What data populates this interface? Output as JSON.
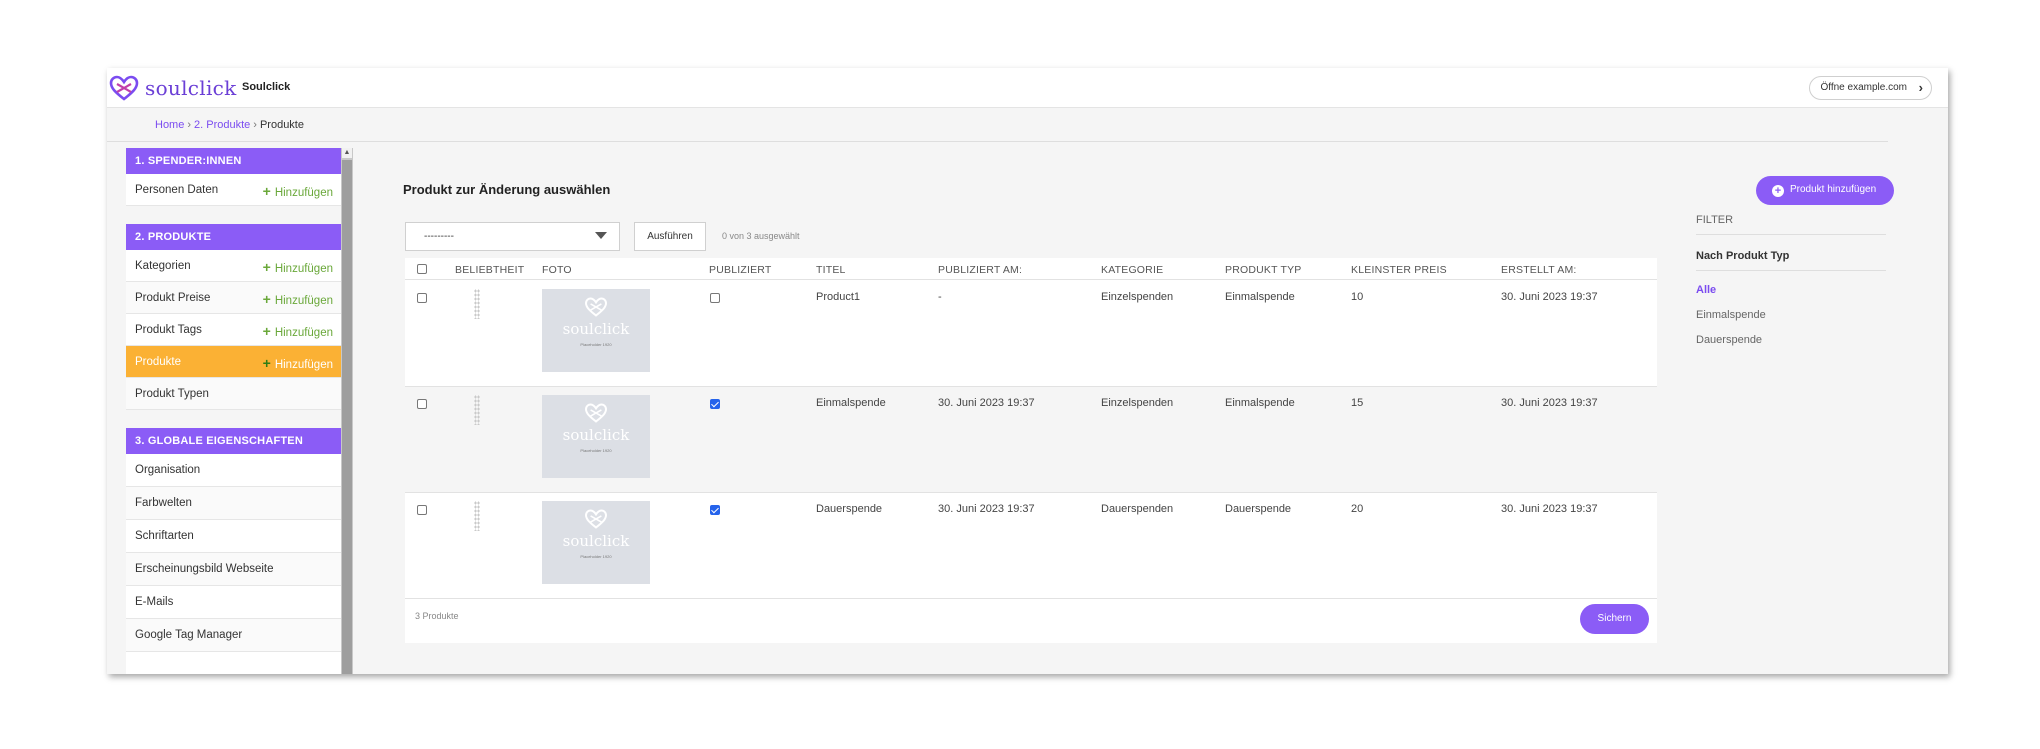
{
  "header": {
    "logo_text": "soulclick",
    "site_name": "Soulclick",
    "open_site_label": "Öffne example.com"
  },
  "breadcrumb": {
    "home": "Home",
    "section": "2. Produkte",
    "current": "Produkte",
    "separator": "›"
  },
  "sidebar": {
    "add_label": "Hinzufügen",
    "sections": [
      {
        "title": "1. SPENDER:INNEN",
        "items": [
          {
            "label": "Personen Daten",
            "add": true
          }
        ]
      },
      {
        "title": "2. PRODUKTE",
        "items": [
          {
            "label": "Kategorien",
            "add": true
          },
          {
            "label": "Produkt Preise",
            "add": true
          },
          {
            "label": "Produkt Tags",
            "add": true
          },
          {
            "label": "Produkte",
            "add": true,
            "active": true
          },
          {
            "label": "Produkt Typen",
            "add": false
          }
        ]
      },
      {
        "title": "3. GLOBALE EIGENSCHAFTEN",
        "items": [
          {
            "label": "Organisation"
          },
          {
            "label": "Farbwelten"
          },
          {
            "label": "Schriftarten"
          },
          {
            "label": "Erscheinungsbild Webseite"
          },
          {
            "label": "E-Mails"
          },
          {
            "label": "Google Tag Manager"
          }
        ]
      }
    ]
  },
  "main": {
    "title": "Produkt zur Änderung auswählen",
    "add_button": "Produkt hinzufügen",
    "action_select_value": "---------",
    "run_button": "Ausführen",
    "selected_count": "0 von 3 ausgewählt",
    "table": {
      "columns": [
        "BELIEBTHEIT",
        "FOTO",
        "PUBLIZIERT",
        "TITEL",
        "PUBLIZIERT AM:",
        "KATEGORIE",
        "PRODUKT TYP",
        "KLEINSTER PREIS",
        "ERSTELLT AM:"
      ],
      "placeholder_text": "soulclick",
      "placeholder_caption": "Placeholder 1920",
      "rows": [
        {
          "published": false,
          "title": "Product1",
          "published_at": "-",
          "category": "Einzelspenden",
          "type": "Einmalspende",
          "min_price": "10",
          "created_at": "30. Juni 2023 19:37"
        },
        {
          "published": true,
          "title": "Einmalspende",
          "published_at": "30. Juni 2023 19:37",
          "category": "Einzelspenden",
          "type": "Einmalspende",
          "min_price": "15",
          "created_at": "30. Juni 2023 19:37"
        },
        {
          "published": true,
          "title": "Dauerspende",
          "published_at": "30. Juni 2023 19:37",
          "category": "Dauerspenden",
          "type": "Dauerspende",
          "min_price": "20",
          "created_at": "30. Juni 2023 19:37"
        }
      ],
      "footer_count": "3 Produkte",
      "save_button": "Sichern"
    }
  },
  "filter": {
    "title": "FILTER",
    "subtitle": "Nach Produkt Typ",
    "options": [
      {
        "label": "Alle",
        "selected": true
      },
      {
        "label": "Einmalspende",
        "selected": false
      },
      {
        "label": "Dauerspende",
        "selected": false
      }
    ]
  },
  "colors": {
    "accent": "#8b5cf6",
    "active_item": "#fbb134",
    "add_green": "#6aa83a",
    "checkbox_checked": "#2563eb"
  }
}
